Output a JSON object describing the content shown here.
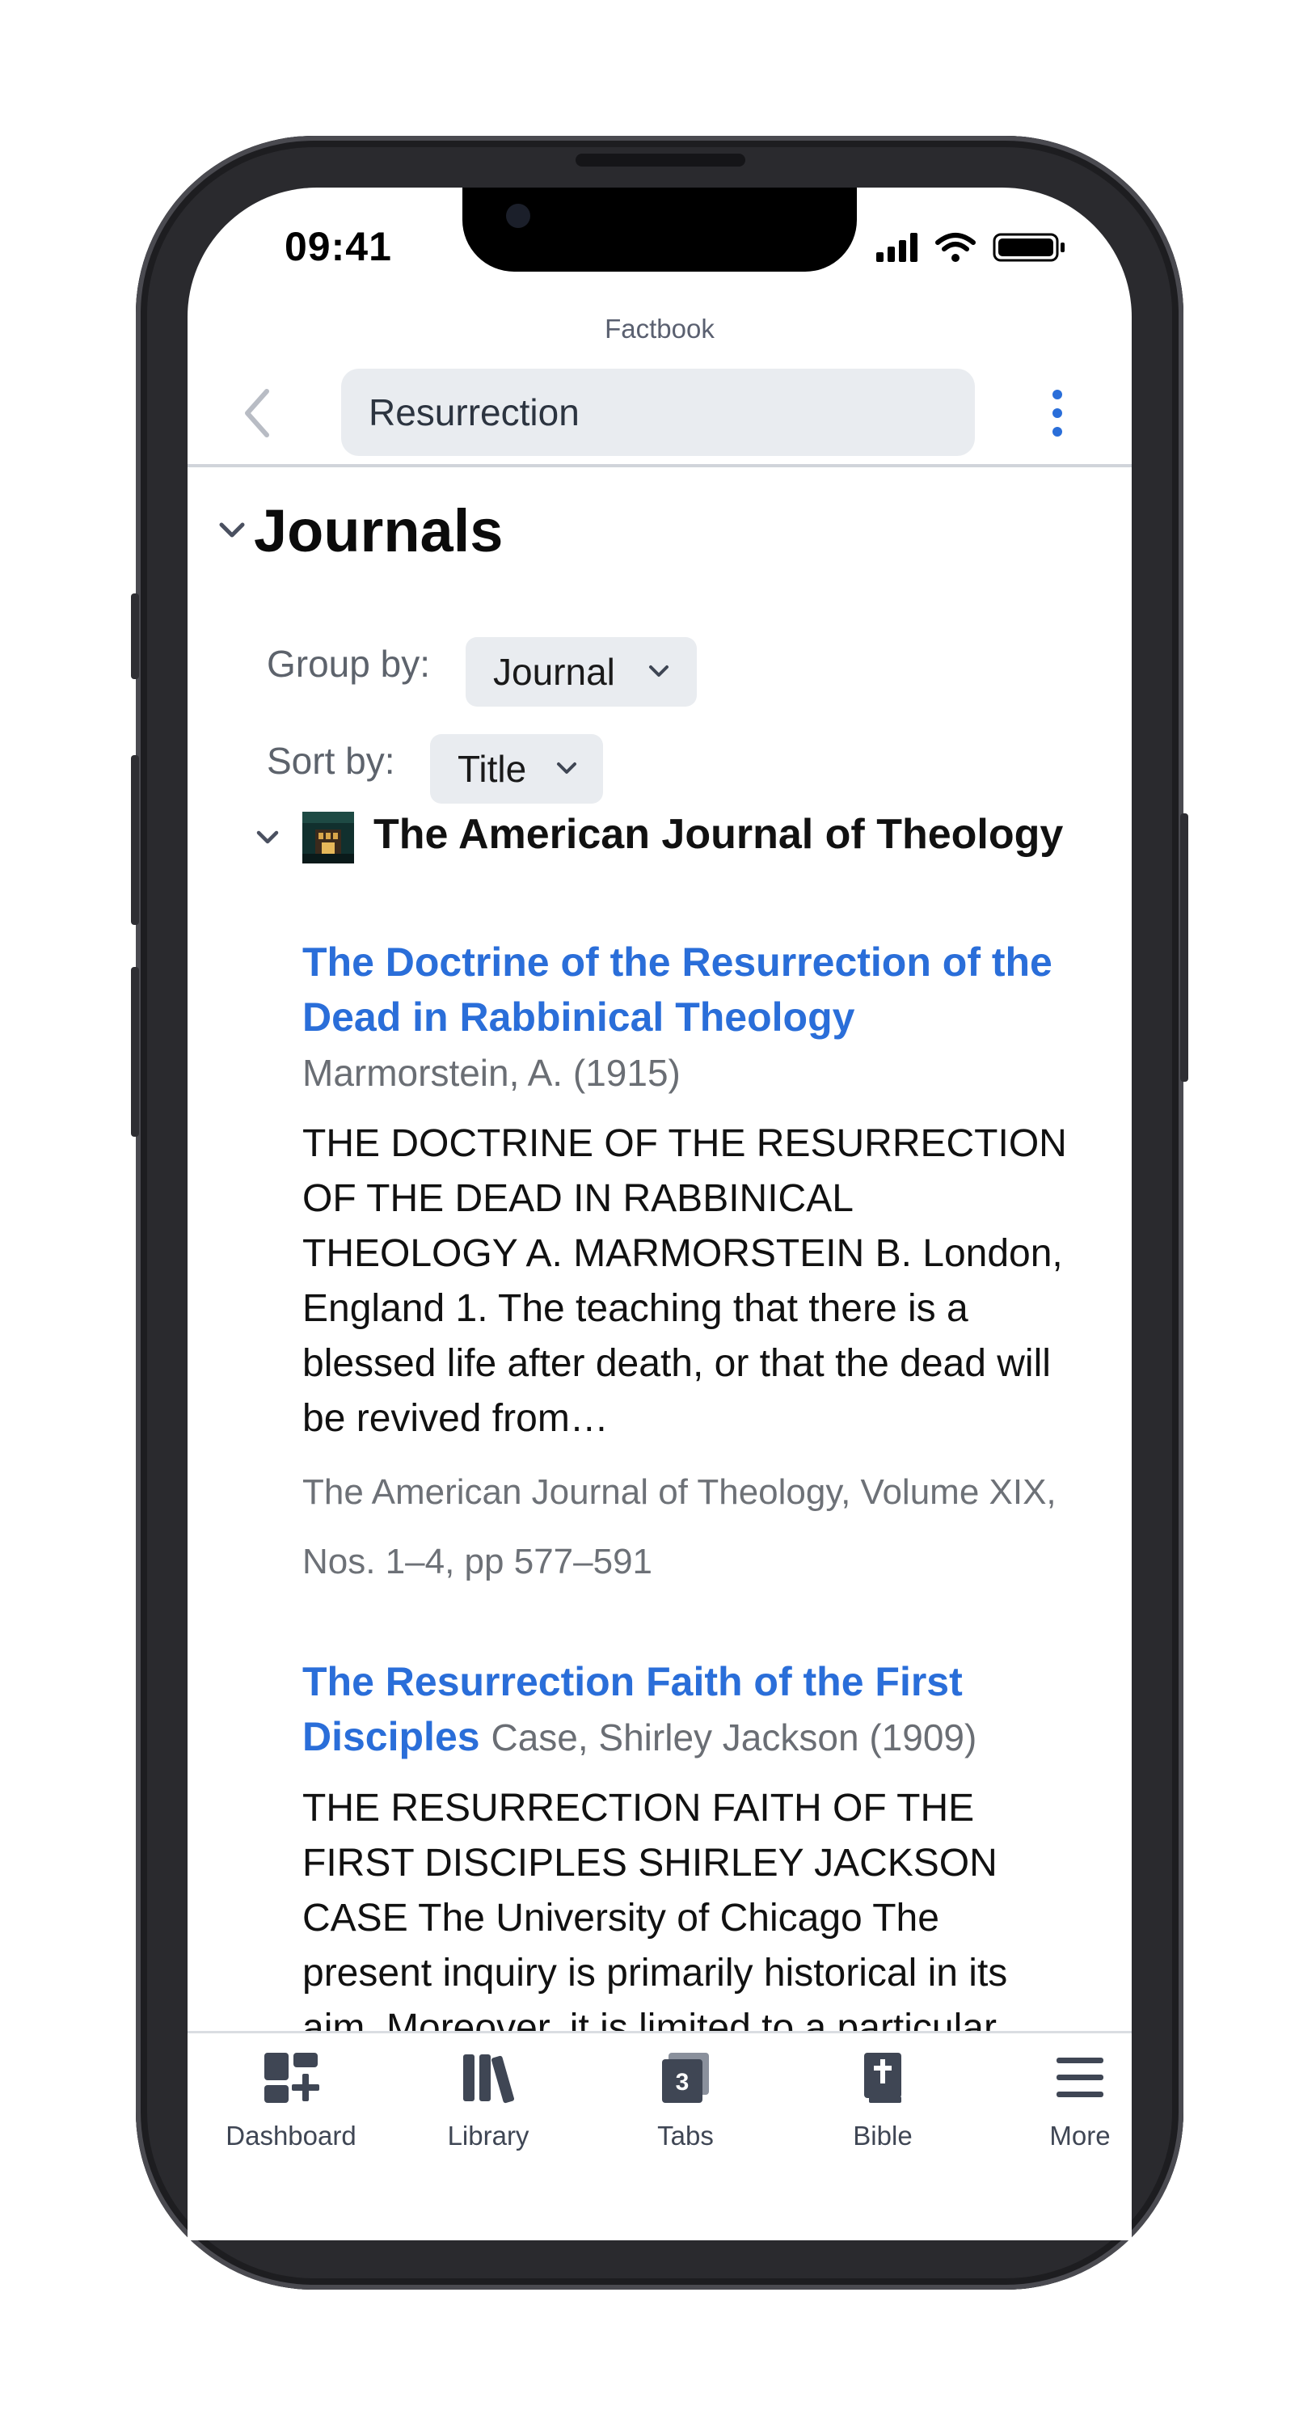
{
  "status_bar": {
    "time": "09:41"
  },
  "header": {
    "subtitle": "Factbook",
    "search_value": "Resurrection"
  },
  "section": {
    "title": "Journals",
    "group_by_label": "Group by:",
    "group_by_value": "Journal",
    "sort_by_label": "Sort by:",
    "sort_by_value": "Title"
  },
  "journal_group": {
    "name": "The American Journal of Theology",
    "name_suffix": "(…"
  },
  "results": [
    {
      "title": "The Doctrine of the Resurrection of the Dead in Rabbinical Theology",
      "author_year": "Marmorstein, A. (1915)",
      "excerpt": "THE DOCTRINE OF THE RESURRECTION OF THE DEAD IN RABBINICAL THEOLOGY A. MARMORSTEIN B. London, England 1. The teaching that there is a blessed life after death, or that the dead will be revived from…",
      "source": "The American Journal of Theology, Volume XIX, Nos. 1–4, pp 577–591"
    },
    {
      "title": "The Resurrection Faith of the First Disciples",
      "author_year": "Case, Shirley Jackson (1909)",
      "excerpt": "THE RESURRECTION FAITH OF THE FIRST DISCIPLES SHIRLEY JACKSON CASE The University of Chicago The present inquiry is primarily historical in its aim. Moreover, it is limited to a particular item in the…"
    }
  ],
  "tabbar": {
    "items": [
      {
        "label": "Dashboard",
        "icon": "dashboard-icon"
      },
      {
        "label": "Library",
        "icon": "library-icon"
      },
      {
        "label": "Tabs",
        "icon": "tabs-icon",
        "badge": "3"
      },
      {
        "label": "Bible",
        "icon": "bible-icon"
      },
      {
        "label": "More",
        "icon": "menu-icon"
      }
    ]
  },
  "colors": {
    "link_blue": "#2a6ed9",
    "tab_icon": "#3f4654",
    "control_bg": "#e9ecf0"
  }
}
